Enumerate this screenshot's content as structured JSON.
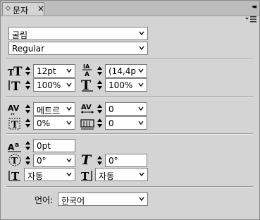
{
  "panel": {
    "tab_label": "문자",
    "tab_close": "×",
    "collapse_glyph": "◂◂",
    "icons": [
      "diamond-icon",
      "close-icon",
      "collapse-icon",
      "panel-menu-icon"
    ]
  },
  "font": {
    "family": "굴림",
    "style": "Regular"
  },
  "size_section": {
    "font_size": "12pt",
    "leading": "(14,4p",
    "vertical_scale": "100%",
    "horizontal_scale": "100%"
  },
  "spacing_section": {
    "kerning": "메트르",
    "tracking": "0",
    "tsume": "0%",
    "mojikumi": "0"
  },
  "baseline_section": {
    "baseline_shift": "0pt",
    "rotation": "0°",
    "skew": "0°",
    "aki_before": "자동",
    "aki_after": "자동"
  },
  "language": {
    "label": "언어:",
    "value": "한국어"
  }
}
